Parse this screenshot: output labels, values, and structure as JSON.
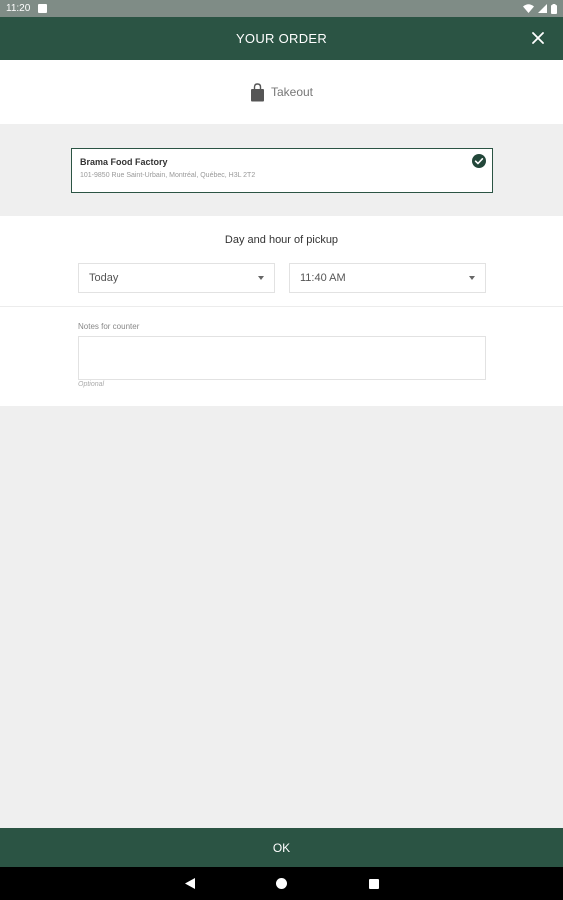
{
  "status_bar": {
    "time": "11:20",
    "icons": [
      "notification-icon",
      "wifi-icon",
      "signal-icon",
      "battery-icon"
    ]
  },
  "app_bar": {
    "title": "YOUR ORDER",
    "close_icon": "close-icon"
  },
  "order_mode": {
    "label": "Takeout",
    "icon": "shopping-bag-icon"
  },
  "store": {
    "name": "Brama Food Factory",
    "address": "101-9850 Rue Saint-Urbain, Montréal, Québec, H3L 2T2",
    "selected": true,
    "check_icon": "check-circle-icon"
  },
  "pickup": {
    "title": "Day and hour of pickup",
    "day_value": "Today",
    "time_value": "11:40 AM"
  },
  "notes": {
    "label": "Notes for counter",
    "value": "",
    "helper": "Optional"
  },
  "footer": {
    "ok_label": "OK"
  },
  "nav": {
    "icons": [
      "back-icon",
      "home-icon",
      "recents-icon"
    ]
  },
  "colors": {
    "primary": "#2b5444",
    "background": "#efefef",
    "status_bar": "#7f8c86"
  }
}
